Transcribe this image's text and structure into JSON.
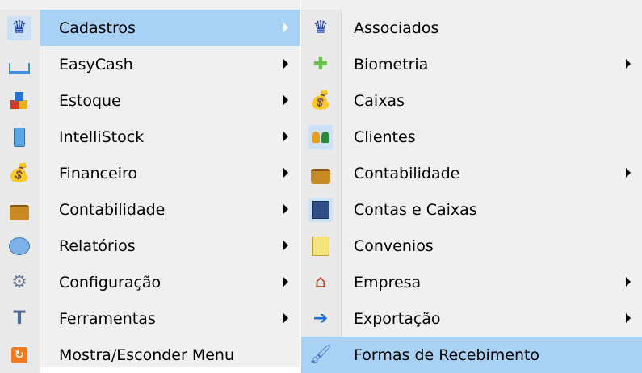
{
  "menu_left": {
    "items": [
      {
        "label": "Cadastros",
        "icon": "user-star-icon",
        "submenu": true,
        "highlighted": true
      },
      {
        "label": "EasyCash",
        "icon": "cash-register-icon",
        "submenu": true
      },
      {
        "label": "Estoque",
        "icon": "boxes-icon",
        "submenu": true
      },
      {
        "label": "IntelliStock",
        "icon": "phone-device-icon",
        "submenu": true
      },
      {
        "label": "Financeiro",
        "icon": "money-bag-icon",
        "submenu": true
      },
      {
        "label": "Contabilidade",
        "icon": "briefcase-icon",
        "submenu": true
      },
      {
        "label": "Relatórios",
        "icon": "pie-chart-icon",
        "submenu": true
      },
      {
        "label": "Configuração",
        "icon": "settings-gear-icon",
        "submenu": true
      },
      {
        "label": "Ferramentas",
        "icon": "hammer-icon",
        "submenu": true
      },
      {
        "label": "Mostra/Esconder Menu",
        "icon": "toggle-menu-icon",
        "submenu": false
      }
    ]
  },
  "menu_right": {
    "items": [
      {
        "label": "Associados",
        "icon": "user-star-icon",
        "submenu": false
      },
      {
        "label": "Biometria",
        "icon": "puzzle-icon",
        "submenu": true
      },
      {
        "label": "Caixas",
        "icon": "money-bag-icon",
        "submenu": false
      },
      {
        "label": "Clientes",
        "icon": "people-icon",
        "submenu": false
      },
      {
        "label": "Contabilidade",
        "icon": "briefcase-icon",
        "submenu": true
      },
      {
        "label": "Contas e Caixas",
        "icon": "ledger-icon",
        "submenu": false
      },
      {
        "label": "Convenios",
        "icon": "note-icon",
        "submenu": false
      },
      {
        "label": "Empresa",
        "icon": "house-icon",
        "submenu": true
      },
      {
        "label": "Exportação",
        "icon": "arrow-right-icon",
        "submenu": true
      },
      {
        "label": "Formas de Recebimento",
        "icon": "brush-icon",
        "submenu": false,
        "highlighted": true
      }
    ]
  },
  "colors": {
    "menu_bg": "#f0f0f0",
    "highlight": "#a8d1f6",
    "gutter": "#e9e9e9"
  }
}
